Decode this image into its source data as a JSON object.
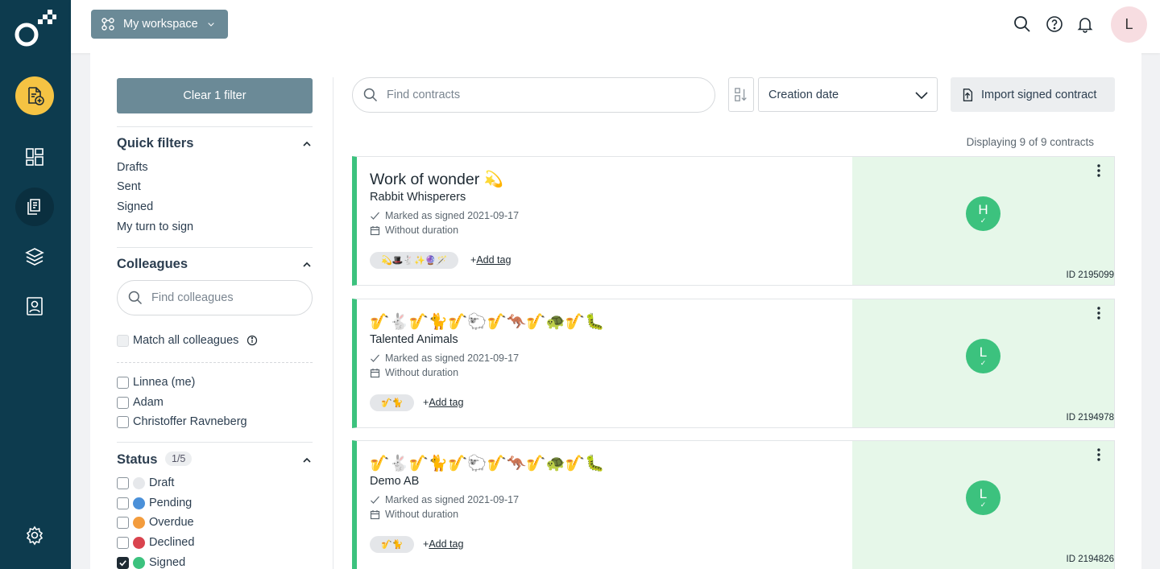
{
  "topbar": {
    "workspace_label": "My workspace",
    "user_initial": "L"
  },
  "sidebar": {
    "clear_filter_label": "Clear 1 filter",
    "quick_filters": {
      "title": "Quick filters",
      "items": [
        "Drafts",
        "Sent",
        "Signed",
        "My turn to sign"
      ]
    },
    "colleagues": {
      "title": "Colleagues",
      "search_placeholder": "Find colleagues",
      "match_all_label": "Match all colleagues",
      "people": [
        "Linnea (me)",
        "Adam",
        "Christoffer Ravneberg"
      ]
    },
    "status": {
      "title": "Status",
      "badge": "1/5",
      "items": [
        {
          "label": "Draft",
          "color": "#e6e8eb",
          "checked": false
        },
        {
          "label": "Pending",
          "color": "#4a90d9",
          "checked": false
        },
        {
          "label": "Overdue",
          "color": "#f39c3d",
          "checked": false
        },
        {
          "label": "Declined",
          "color": "#d9434e",
          "checked": false
        },
        {
          "label": "Signed",
          "color": "#3cc27e",
          "checked": true
        }
      ]
    }
  },
  "toolbar": {
    "search_placeholder": "Find contracts",
    "sort_value": "Creation date",
    "import_label": "Import signed contract",
    "displaying_text": "Displaying 9 of 9 contracts"
  },
  "contracts": [
    {
      "title": "Work of wonder 💫",
      "party": "Rabbit Whisperers",
      "status_text": "Marked as signed 2021-09-17",
      "duration_text": "Without duration",
      "tags": "💫🎩🐇✨🔮🪄",
      "add_tag": "Add tag",
      "signer_initial": "H",
      "id_text": "ID 2195099"
    },
    {
      "title": "🎷🐇🎷🐈🎷🐑🎷🦘🎷🐢🎷🐛",
      "party": "Talented Animals",
      "status_text": "Marked as signed 2021-09-17",
      "duration_text": "Without duration",
      "tags": "🎷🐈",
      "add_tag": "Add tag",
      "signer_initial": "L",
      "id_text": "ID 2194978"
    },
    {
      "title": "🎷🐇🎷🐈🎷🐑🎷🦘🎷🐢🎷🐛",
      "party": "Demo AB",
      "status_text": "Marked as signed 2021-09-17",
      "duration_text": "Without duration",
      "tags": "🎷🐈",
      "add_tag": "Add tag",
      "signer_initial": "L",
      "id_text": "ID 2194826"
    }
  ],
  "icons": {
    "rail": [
      "logo-icon",
      "create-document-icon",
      "dashboard-icon",
      "documents-icon",
      "templates-icon",
      "contacts-icon",
      "settings-icon"
    ],
    "top": [
      "search-icon",
      "help-icon",
      "bell-icon"
    ]
  },
  "colors": {
    "rail_bg": "#0d3b4e",
    "accent_yellow": "#f5c343",
    "signed_green": "#3cc27e",
    "card_signed_bg": "#e6f7e9",
    "button_slate": "#6b8a97"
  }
}
